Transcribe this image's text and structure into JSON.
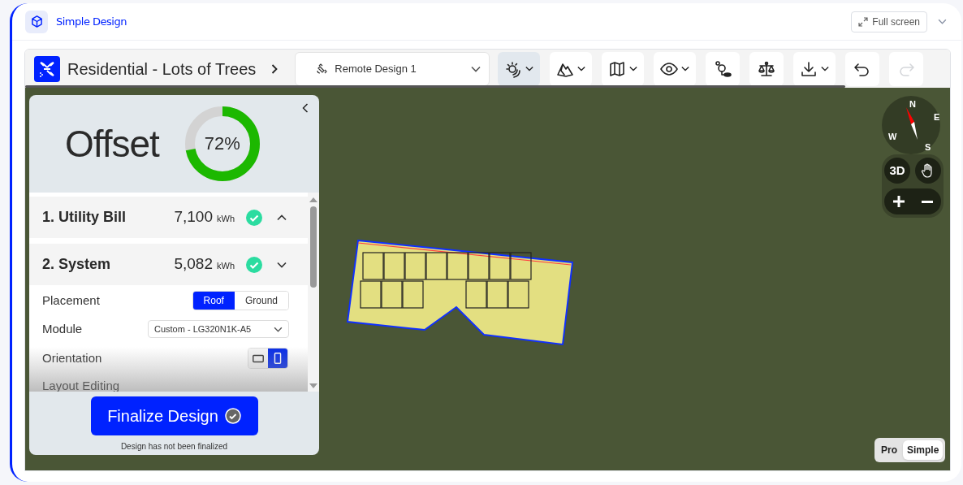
{
  "app": {
    "title": "Simple Design",
    "full_screen": "Full screen"
  },
  "project": {
    "title": "Residential - Lots of Trees",
    "design": "Remote Design 1"
  },
  "toolbar": [
    {
      "kind": "menu",
      "selected": true,
      "disabled": false
    },
    {
      "kind": "menu",
      "selected": false,
      "disabled": false
    },
    {
      "kind": "menu",
      "selected": false,
      "disabled": false
    },
    {
      "kind": "menu",
      "selected": false,
      "disabled": false
    },
    {
      "kind": "button",
      "selected": false,
      "disabled": false
    },
    {
      "kind": "button",
      "selected": false,
      "disabled": false
    },
    {
      "kind": "menu",
      "selected": false,
      "disabled": false
    },
    {
      "kind": "button",
      "selected": false,
      "disabled": false
    },
    {
      "kind": "button",
      "selected": false,
      "disabled": true
    }
  ],
  "offset": {
    "title": "Offset",
    "reading": "72%",
    "level": 0.72
  },
  "sections": [
    {
      "title": "1. Utility Bill",
      "value": "7,100",
      "unit": "kWh",
      "complete": true,
      "expanded": false
    },
    {
      "title": "2. System",
      "value": "5,082",
      "unit": "kWh",
      "complete": true,
      "expanded": true
    }
  ],
  "system": {
    "placement": {
      "label": "Placement",
      "options": [
        {
          "label": "Roof",
          "selected": true
        },
        {
          "label": "Ground",
          "selected": false
        }
      ]
    },
    "module": {
      "label": "Module",
      "value": "Custom - LG320N1K-A5"
    },
    "orientation": {
      "label": "Orientation",
      "options": [
        {
          "kind": "landscape",
          "selected": false
        },
        {
          "kind": "portrait",
          "selected": true
        }
      ]
    },
    "next_label": "Layout Editing"
  },
  "finalize": {
    "label": "Finalize Design",
    "note": "Design has not been finalized"
  },
  "map": {
    "compass": [
      "N",
      "E",
      "W",
      "S"
    ],
    "view_3d": "3D",
    "modes": [
      {
        "label": "Pro",
        "selected": false
      },
      {
        "label": "Simple",
        "selected": true
      }
    ]
  }
}
